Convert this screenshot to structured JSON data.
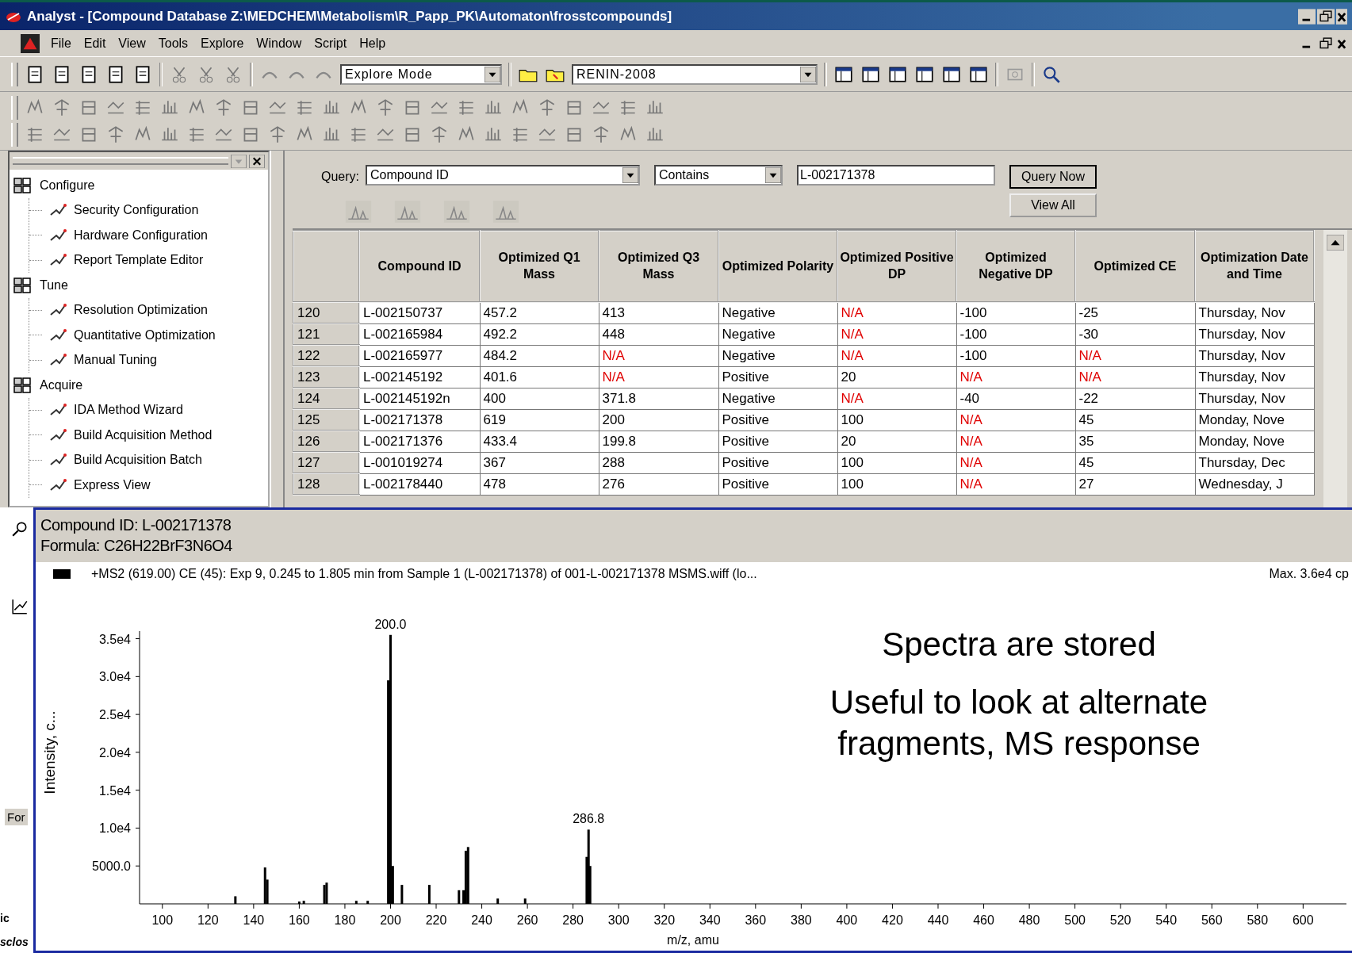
{
  "window": {
    "title": "Analyst - [Compound Database Z:\\MEDCHEM\\Metabolism\\R_Papp_PK\\Automaton\\frosstcompounds]"
  },
  "menu": [
    "File",
    "Edit",
    "View",
    "Tools",
    "Explore",
    "Window",
    "Script",
    "Help"
  ],
  "toolbar": {
    "mode": "Explore Mode",
    "project": "RENIN-2008"
  },
  "sidebar": {
    "items": [
      {
        "label": "Configure",
        "expanded": true,
        "children": [
          {
            "label": "Security Configuration"
          },
          {
            "label": "Hardware Configuration"
          },
          {
            "label": "Report Template Editor"
          }
        ]
      },
      {
        "label": "Tune",
        "expanded": true,
        "children": [
          {
            "label": "Resolution Optimization"
          },
          {
            "label": "Quantitative Optimization"
          },
          {
            "label": "Manual Tuning"
          }
        ]
      },
      {
        "label": "Acquire",
        "expanded": true,
        "children": [
          {
            "label": "IDA Method Wizard"
          },
          {
            "label": "Build Acquisition Method"
          },
          {
            "label": "Build Acquisition Batch"
          },
          {
            "label": "Express View"
          }
        ]
      }
    ]
  },
  "query": {
    "label": "Query:",
    "field": "Compound ID",
    "operator": "Contains",
    "value": "L-002171378",
    "buttons": [
      "Query Now",
      "View All"
    ]
  },
  "table": {
    "columns": [
      "Compound ID",
      "Optimized Q1 Mass",
      "Optimized Q3 Mass",
      "Optimized Polarity",
      "Optimized Positive DP",
      "Optimized Negative DP",
      "Optimized CE",
      "Optimization Date and Time"
    ],
    "rows": [
      {
        "num": "120",
        "cells": [
          "L-002150737",
          "457.2",
          "413",
          "Negative",
          "N/A",
          "-100",
          "-25",
          "Thursday, Nov"
        ],
        "flagged": [
          false,
          false,
          false,
          false,
          true,
          false,
          false,
          false
        ]
      },
      {
        "num": "121",
        "cells": [
          "L-002165984",
          "492.2",
          "448",
          "Negative",
          "N/A",
          "-100",
          "-30",
          "Thursday, Nov"
        ],
        "flagged": [
          false,
          false,
          false,
          false,
          true,
          false,
          false,
          false
        ]
      },
      {
        "num": "122",
        "cells": [
          "L-002165977",
          "484.2",
          "N/A",
          "Negative",
          "N/A",
          "-100",
          "N/A",
          "Thursday, Nov"
        ],
        "flagged": [
          false,
          false,
          true,
          false,
          true,
          false,
          true,
          false
        ]
      },
      {
        "num": "123",
        "cells": [
          "L-002145192",
          "401.6",
          "N/A",
          "Positive",
          "20",
          "N/A",
          "N/A",
          "Thursday, Nov"
        ],
        "flagged": [
          false,
          false,
          true,
          false,
          false,
          true,
          true,
          false
        ]
      },
      {
        "num": "124",
        "cells": [
          "L-002145192n",
          "400",
          "371.8",
          "Negative",
          "N/A",
          "-40",
          "-22",
          "Thursday, Nov"
        ],
        "flagged": [
          false,
          false,
          false,
          false,
          true,
          false,
          false,
          false
        ]
      },
      {
        "num": "125",
        "cells": [
          "L-002171378",
          "619",
          "200",
          "Positive",
          "100",
          "N/A",
          "45",
          "Monday, Nove"
        ],
        "flagged": [
          false,
          false,
          false,
          false,
          false,
          true,
          false,
          false
        ]
      },
      {
        "num": "126",
        "cells": [
          "L-002171376",
          "433.4",
          "199.8",
          "Positive",
          "20",
          "N/A",
          "35",
          "Monday, Nove"
        ],
        "flagged": [
          false,
          false,
          false,
          false,
          false,
          true,
          false,
          false
        ]
      },
      {
        "num": "127",
        "cells": [
          "L-001019274",
          "367",
          "288",
          "Positive",
          "100",
          "N/A",
          "45",
          "Thursday, Dec"
        ],
        "flagged": [
          false,
          false,
          false,
          false,
          false,
          true,
          false,
          false
        ]
      },
      {
        "num": "128",
        "cells": [
          "L-002178440",
          "478",
          "276",
          "Positive",
          "100",
          "N/A",
          "27",
          "Wednesday, J"
        ],
        "flagged": [
          false,
          false,
          false,
          false,
          false,
          true,
          false,
          false
        ]
      }
    ]
  },
  "left_strip": {
    "button": "For",
    "fragments": [
      "ic",
      "sclos"
    ]
  },
  "spectrum": {
    "compound": "Compound ID: L-002171378",
    "formula": "Formula: C26H22BrF3N6O4",
    "legend": "+MS2 (619.00) CE (45): Exp 9, 0.245 to 1.805 min from Sample 1 (L-002171378) of 001-L-002171378 MSMS.wiff (lo...",
    "max": "Max. 3.6e4 cp",
    "notes": [
      "Spectra are stored",
      "Useful to look at alternate fragments, MS response"
    ],
    "chart_data": {
      "type": "bar",
      "xlabel": "m/z, amu",
      "ylabel": "Intensity, c...",
      "x": [
        132,
        145,
        146,
        160,
        162,
        171,
        172,
        185,
        190,
        199,
        200,
        201,
        205,
        217,
        230,
        232,
        233,
        234,
        247,
        259,
        286,
        286.8,
        287.5
      ],
      "values": [
        1000,
        4800,
        3200,
        300,
        400,
        2500,
        2800,
        400,
        400,
        29500,
        35500,
        5000,
        2500,
        2500,
        1800,
        1800,
        7000,
        7500,
        700,
        700,
        6200,
        9800,
        5000
      ],
      "xlim": [
        90,
        619
      ],
      "ylim": [
        0,
        36000
      ],
      "xticks": [
        100,
        120,
        140,
        160,
        180,
        200,
        220,
        240,
        260,
        280,
        300,
        320,
        340,
        360,
        380,
        400,
        420,
        440,
        460,
        480,
        500,
        520,
        540,
        560,
        580,
        600
      ],
      "yticks": [
        {
          "value": 5000,
          "label": "5000.0"
        },
        {
          "value": 10000,
          "label": "1.0e4"
        },
        {
          "value": 15000,
          "label": "1.5e4"
        },
        {
          "value": 20000,
          "label": "2.0e4"
        },
        {
          "value": 25000,
          "label": "2.5e4"
        },
        {
          "value": 30000,
          "label": "3.0e4"
        },
        {
          "value": 35000,
          "label": "3.5e4"
        }
      ],
      "annotations": [
        {
          "x": 200,
          "y": 35500,
          "text": "200.0"
        },
        {
          "x": 286.8,
          "y": 9800,
          "text": "286.8"
        }
      ]
    }
  }
}
